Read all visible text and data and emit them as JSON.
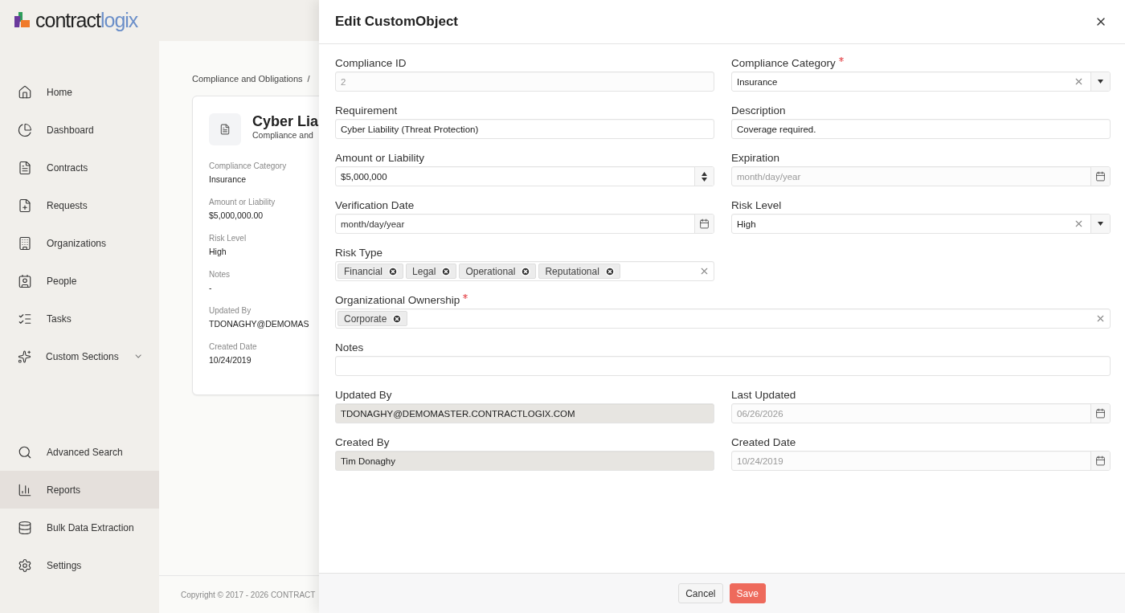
{
  "logo": {
    "wordmark_a": "contract",
    "wordmark_b": "logix"
  },
  "sidebar": {
    "items": [
      {
        "label": "Home",
        "kind": "home",
        "selected": false
      },
      {
        "label": "Dashboard",
        "kind": "dashboard",
        "selected": false
      },
      {
        "label": "Contracts",
        "kind": "contracts",
        "selected": false
      },
      {
        "label": "Requests",
        "kind": "requests",
        "selected": false
      },
      {
        "label": "Organizations",
        "kind": "organizations",
        "selected": false
      },
      {
        "label": "People",
        "kind": "people",
        "selected": false
      },
      {
        "label": "Tasks",
        "kind": "tasks",
        "selected": false
      },
      {
        "label": "Custom Sections",
        "kind": "custom",
        "selected": false,
        "expanded": false
      }
    ],
    "bottom_items": [
      {
        "label": "Advanced Search",
        "kind": "search",
        "selected": false
      },
      {
        "label": "Reports",
        "kind": "reports",
        "selected": true
      },
      {
        "label": "Bulk Data Extraction",
        "kind": "database",
        "selected": false
      },
      {
        "label": "Settings",
        "kind": "settings",
        "selected": false
      }
    ]
  },
  "breadcrumb": {
    "items": [
      "Compliance and Obligations"
    ],
    "separator": "/"
  },
  "record_card": {
    "title": "Cyber Lia",
    "subtitle": "Compliance and",
    "details": [
      {
        "label": "Compliance Category",
        "value": "Insurance"
      },
      {
        "label": "Amount or Liability",
        "value": "$5,000,000.00"
      },
      {
        "label": "Risk Level",
        "value": "High"
      },
      {
        "label": "Notes",
        "value": "-"
      },
      {
        "label": "Updated By",
        "value": "TDONAGHY@DEMOMAS"
      },
      {
        "label": "Created Date",
        "value": "10/24/2019"
      }
    ]
  },
  "footer": {
    "copyright": "Copyright © 2017 - 2026 CONTRACT"
  },
  "drawer": {
    "title": "Edit CustomObject",
    "rows": [
      [
        {
          "label": "Compliance ID",
          "kind": "text",
          "required": false,
          "disabled": true,
          "wide": false,
          "value": "2"
        },
        {
          "label": "Compliance Category",
          "kind": "select",
          "required": true,
          "disabled": false,
          "wide": false,
          "value": "Insurance"
        }
      ],
      [
        {
          "label": "Requirement",
          "kind": "text",
          "required": false,
          "disabled": false,
          "wide": false,
          "value": "Cyber Liability (Threat Protection)"
        },
        {
          "label": "Description",
          "kind": "text",
          "required": false,
          "disabled": false,
          "wide": false,
          "value": "Coverage required."
        }
      ],
      [
        {
          "label": "Amount or Liability",
          "kind": "number",
          "required": false,
          "disabled": false,
          "wide": false,
          "value": "$5,000,000"
        },
        {
          "label": "Expiration",
          "kind": "date",
          "required": false,
          "disabled": true,
          "wide": false,
          "placeholder": "month/day/year"
        }
      ],
      [
        {
          "label": "Verification Date",
          "kind": "date",
          "required": false,
          "disabled": false,
          "wide": false,
          "placeholder": "month/day/year"
        },
        {
          "label": "Risk Level",
          "kind": "select",
          "required": false,
          "disabled": false,
          "wide": false,
          "value": "High"
        }
      ],
      [
        {
          "label": "Risk Type",
          "kind": "tags",
          "required": false,
          "wide": false,
          "tags": [
            "Financial",
            "Legal",
            "Operational",
            "Reputational"
          ]
        }
      ],
      [
        {
          "label": "Organizational Ownership",
          "kind": "tags",
          "required": true,
          "wide": true,
          "tags": [
            "Corporate"
          ]
        }
      ],
      [
        {
          "label": "Notes",
          "kind": "text",
          "required": false,
          "wide": true
        }
      ],
      [
        {
          "label": "Updated By",
          "kind": "readonly",
          "required": false,
          "wide": false,
          "value": "TDONAGHY@DEMOMASTER.CONTRACTLOGIX.COM"
        },
        {
          "label": "Last Updated",
          "kind": "date",
          "required": false,
          "disabled": true,
          "wide": false,
          "value": "06/26/2026"
        }
      ],
      [
        {
          "label": "Created By",
          "kind": "readonly",
          "required": false,
          "wide": false,
          "value": "Tim Donaghy"
        },
        {
          "label": "Created Date",
          "kind": "date",
          "required": false,
          "disabled": true,
          "wide": false,
          "value": "10/24/2019"
        }
      ]
    ],
    "buttons": [
      {
        "label": "Cancel",
        "kind": "secondary"
      },
      {
        "label": "Save",
        "kind": "primary"
      }
    ]
  }
}
